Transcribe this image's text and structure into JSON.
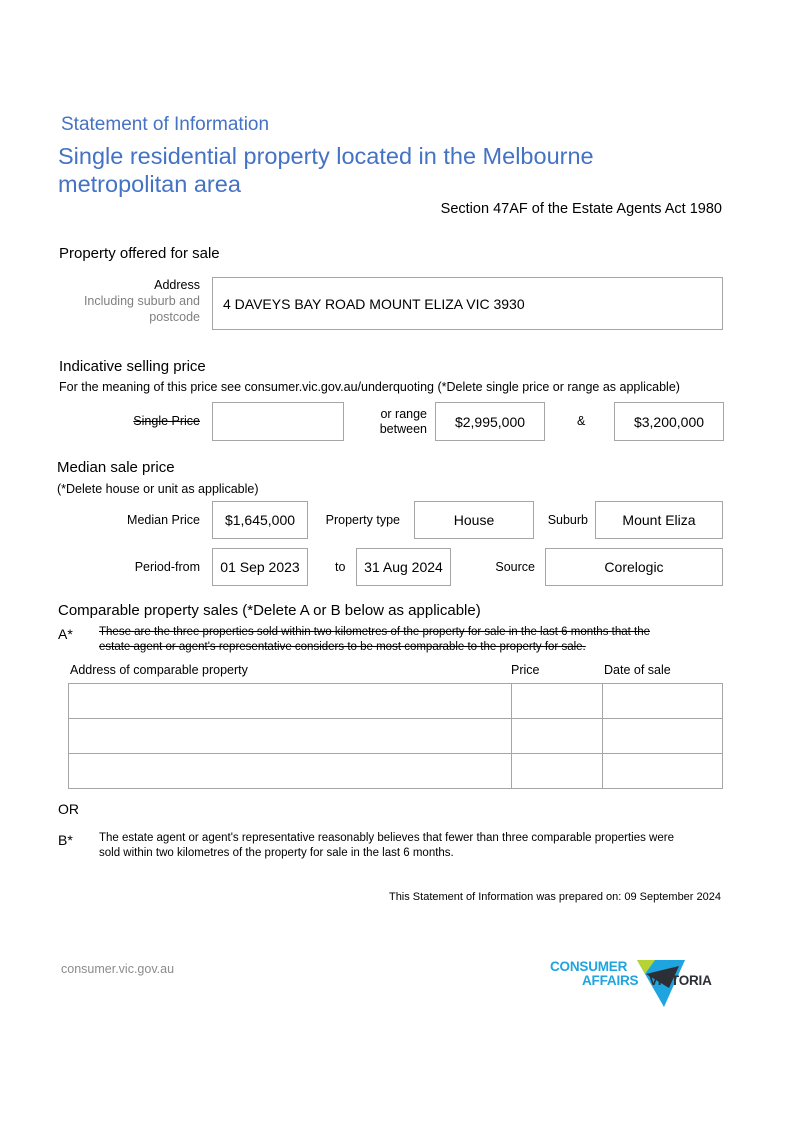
{
  "header": {
    "kicker": "Statement of Information",
    "title_line1": "Single residential property located in the Melbourne",
    "title_line2": "metropolitan area",
    "act_reference": "Section 47AF of the Estate Agents Act 1980"
  },
  "property": {
    "section_title": "Property offered for sale",
    "address_label": "Address",
    "address_sublabel_line1": "Including suburb and",
    "address_sublabel_line2": "postcode",
    "address_value": "4 DAVEYS BAY ROAD MOUNT ELIZA VIC 3930"
  },
  "indicative_price": {
    "section_title": "Indicative selling price",
    "note": "For the meaning of this price see consumer.vic.gov.au/underquoting (*Delete single price or range as applicable)",
    "single_price_label": "Single Price",
    "single_price_value": "",
    "range_label_line1": "or range",
    "range_label_line2": "between",
    "range_low": "$2,995,000",
    "range_sep": "&",
    "range_high": "$3,200,000"
  },
  "median": {
    "section_title": "Median sale price",
    "note": "(*Delete house or unit as applicable)",
    "median_price_label": "Median Price",
    "median_price_value": "$1,645,000",
    "property_type_label": "Property type",
    "property_type_value": "House",
    "suburb_label": "Suburb",
    "suburb_value": "Mount Eliza",
    "period_from_label": "Period-from",
    "period_from_value": "01 Sep 2023",
    "to_label": "to",
    "period_to_value": "31 Aug 2024",
    "source_label": "Source",
    "source_value": "Corelogic"
  },
  "comparable": {
    "section_title": "Comparable property sales (*Delete A or B below as applicable)",
    "a_marker": "A*",
    "a_text_line1": "These are the three properties sold within two kilometres of the property for sale in the last 6 months that the",
    "a_text_line2": "estate agent or agent's representative considers to be most comparable to the property for sale.",
    "columns": [
      "Address of comparable property",
      "Price",
      "Date of sale"
    ],
    "rows": [
      [
        "",
        "",
        ""
      ],
      [
        "",
        "",
        ""
      ],
      [
        "",
        "",
        ""
      ]
    ],
    "or_label": "OR",
    "b_marker": "B*",
    "b_text_line1": "The estate agent or agent's representative reasonably believes that fewer than three comparable properties were",
    "b_text_line2": "sold within two kilometres of the property for sale in the last 6 months."
  },
  "prepared": "This Statement of Information was prepared on: 09 September 2024",
  "footer": {
    "website": "consumer.vic.gov.au",
    "logo_line1": "CONSUMER",
    "logo_line2": "AFFAIRS",
    "logo_word": "VICTORIA",
    "colors": {
      "cyan": "#1ea5e0",
      "lime": "#b5d334",
      "dark": "#2d2f36",
      "blue_heading": "#4472c4"
    }
  }
}
